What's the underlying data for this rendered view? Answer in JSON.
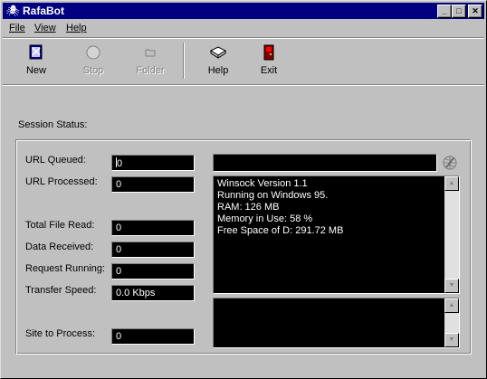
{
  "window": {
    "title": "RafaBot",
    "minimize": "_",
    "maximize": "□",
    "close": "✕"
  },
  "menu": [
    "File",
    "View",
    "Help"
  ],
  "toolbar": {
    "new": "New",
    "stop": "Stop",
    "folder": "Folder",
    "help": "Help",
    "exit": "Exit"
  },
  "session": {
    "label": "Session Status:",
    "fields": [
      {
        "label": "URL Queued:",
        "value": "0"
      },
      {
        "label": "URL Processed:",
        "value": "0"
      },
      {
        "label": "Total File Read:",
        "value": "0"
      },
      {
        "label": "Data Received:",
        "value": "0"
      },
      {
        "label": "Request Running:",
        "value": "0"
      },
      {
        "label": "Transfer Speed:",
        "value": "0.0 Kbps"
      },
      {
        "label": "Site to Process:",
        "value": "0"
      }
    ]
  },
  "url_input": {
    "value": ""
  },
  "info": [
    "Winsock Version 1.1",
    "Running on Windows 95.",
    "RAM: 126 MB",
    "Memory in Use: 58 %",
    "Free Space of D: 291.72 MB"
  ],
  "icons": {
    "app": "spider-icon",
    "new": "new-icon",
    "stop": "stop-icon",
    "folder": "folder-icon",
    "help": "book-icon",
    "exit": "door-icon",
    "globe": "globe-icon"
  },
  "colors": {
    "title_bar": "#000080",
    "panel_bg": "#000000",
    "panel_text": "#ffffff",
    "face": "#c0c0c0"
  }
}
